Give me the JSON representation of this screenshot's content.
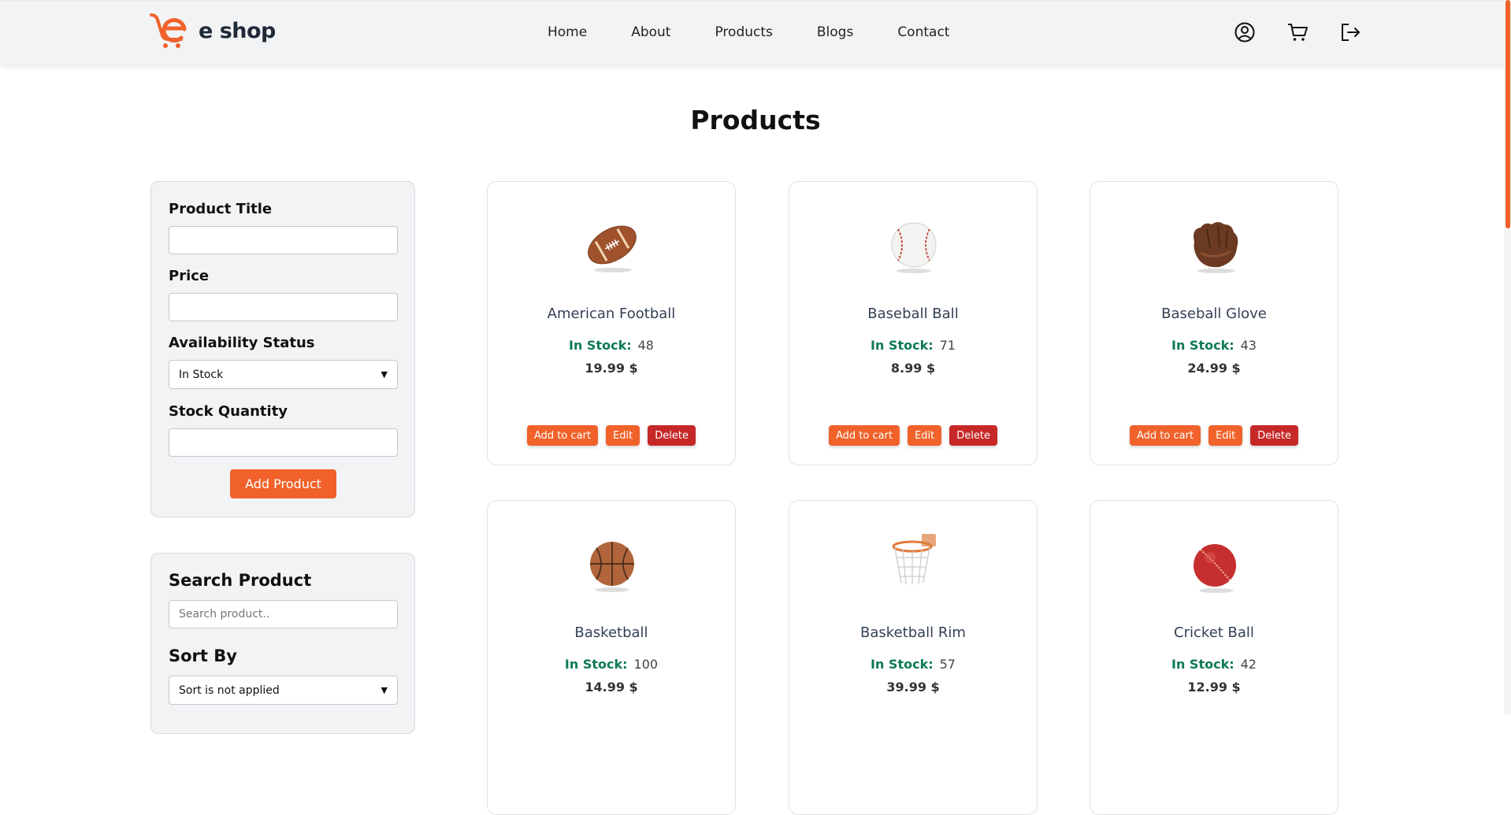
{
  "navbar": {
    "brand": "e shop",
    "links": [
      "Home",
      "About",
      "Products",
      "Blogs",
      "Contact"
    ],
    "icons": [
      "user-circle-icon",
      "cart-icon",
      "logout-icon"
    ]
  },
  "page_title": "Products",
  "add_form": {
    "product_title_label": "Product Title",
    "product_title_value": "",
    "price_label": "Price",
    "price_value": "",
    "availability_label": "Availability Status",
    "availability_value": "In Stock",
    "stock_quantity_label": "Stock Quantity",
    "stock_quantity_value": "",
    "submit_label": "Add Product"
  },
  "search_panel": {
    "search_label": "Search Product",
    "search_placeholder": "Search product..",
    "sort_label": "Sort By",
    "sort_value": "Sort is not applied"
  },
  "products": [
    {
      "name": "American Football",
      "stock_label": "In Stock:",
      "stock": "48",
      "price": "19.99 $",
      "image": "american-football"
    },
    {
      "name": "Baseball Ball",
      "stock_label": "In Stock:",
      "stock": "71",
      "price": "8.99 $",
      "image": "baseball-ball"
    },
    {
      "name": "Baseball Glove",
      "stock_label": "In Stock:",
      "stock": "43",
      "price": "24.99 $",
      "image": "baseball-glove"
    },
    {
      "name": "Basketball",
      "stock_label": "In Stock:",
      "stock": "100",
      "price": "14.99 $",
      "image": "basketball"
    },
    {
      "name": "Basketball Rim",
      "stock_label": "In Stock:",
      "stock": "57",
      "price": "39.99 $",
      "image": "basketball-rim"
    },
    {
      "name": "Cricket Ball",
      "stock_label": "In Stock:",
      "stock": "42",
      "price": "12.99 $",
      "image": "cricket-ball"
    }
  ],
  "card_actions": {
    "add_to_cart": "Add to cart",
    "edit": "Edit",
    "delete": "Delete"
  },
  "colors": {
    "accent": "#f0622a",
    "danger": "#c62828",
    "stock_green": "#0e7a52",
    "panel_bg": "#f2f3f5"
  }
}
